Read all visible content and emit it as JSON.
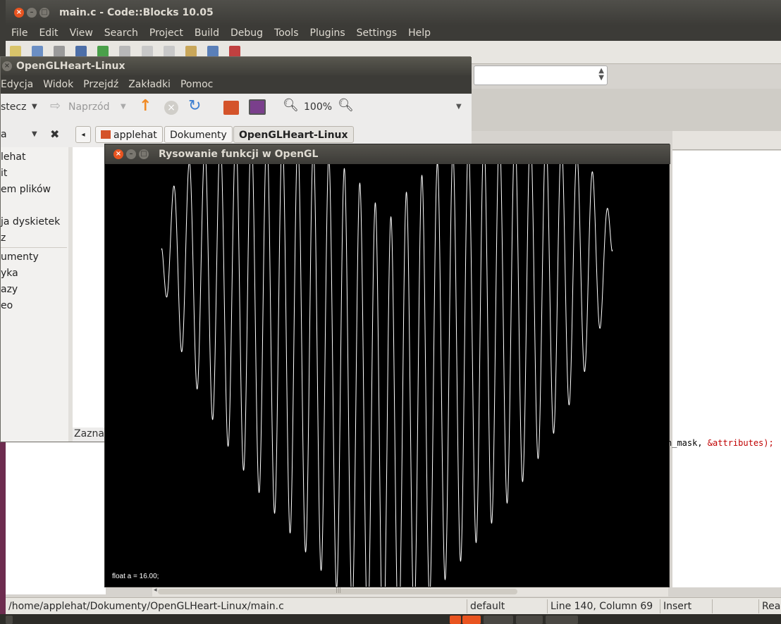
{
  "codeblocks": {
    "title": "main.c - Code::Blocks 10.05",
    "menu": [
      "File",
      "Edit",
      "View",
      "Search",
      "Project",
      "Build",
      "Debug",
      "Tools",
      "Plugins",
      "Settings",
      "Help"
    ],
    "code_visible": "h_mask, &attributes);",
    "code_before_amp": "h_mask, ",
    "code_amp_part": "&attributes",
    "code_after": ");",
    "status": {
      "path": "/home/applehat/Dokumenty/OpenGLHeart-Linux/main.c",
      "encoding": "default",
      "position": "Line 140, Column 69",
      "mode": "Insert",
      "rw": "Rea"
    },
    "scrollbar_grip": "|||"
  },
  "nautilus": {
    "title": "OpenGLHeart-Linux",
    "menu": [
      "Edycja",
      "Widok",
      "Przejdź",
      "Zakładki",
      "Pomoc"
    ],
    "toolbar": {
      "back": "stecz",
      "forward": "Naprzód",
      "zoom": "100%"
    },
    "pathbar": {
      "crumbs": [
        "applehat",
        "Dokumenty",
        "OpenGLHeart-Linux"
      ]
    },
    "sidebar_selector": "a",
    "sidebar": [
      "lehat",
      "it",
      "em plików",
      "ja dyskietek",
      "z",
      "umenty",
      "yka",
      "azy",
      "eo"
    ],
    "statusbar": "Zaznac"
  },
  "gl_window": {
    "title": "Rysowanie funkcji w OpenGL",
    "overlay_text": "float a = 16.00;"
  },
  "colors": {
    "ubuntu_orange": "#e95420",
    "titlebar_dark": "#3c3b37",
    "plot_line": "#ffffff"
  }
}
